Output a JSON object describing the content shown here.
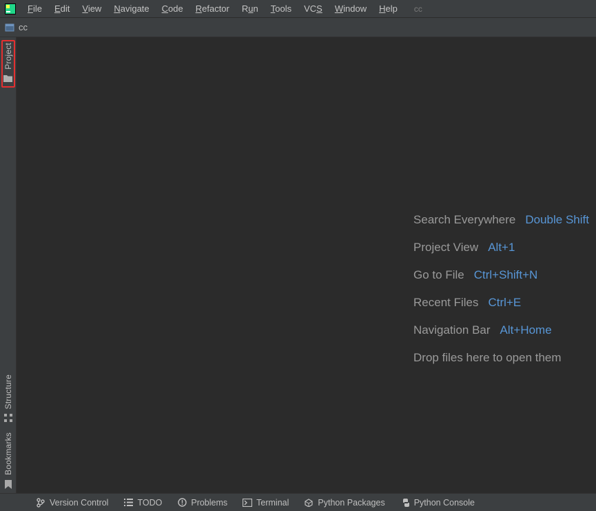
{
  "project_name": "cc",
  "menu": {
    "items": [
      {
        "label": "File",
        "mn": "F"
      },
      {
        "label": "Edit",
        "mn": "E"
      },
      {
        "label": "View",
        "mn": "V"
      },
      {
        "label": "Navigate",
        "mn": "N"
      },
      {
        "label": "Code",
        "mn": "C"
      },
      {
        "label": "Refactor",
        "mn": "R"
      },
      {
        "label": "Run",
        "mn": "u"
      },
      {
        "label": "Tools",
        "mn": "T"
      },
      {
        "label": "VCS",
        "mn": "S"
      },
      {
        "label": "Window",
        "mn": "W"
      },
      {
        "label": "Help",
        "mn": "H"
      }
    ]
  },
  "breadcrumb": {
    "label": "cc"
  },
  "left_tabs": {
    "top": [
      {
        "label": "Project",
        "icon": "folder-icon",
        "highlighted": true
      }
    ],
    "bottom": [
      {
        "label": "Structure",
        "icon": "structure-icon"
      },
      {
        "label": "Bookmarks",
        "icon": "bookmark-icon"
      }
    ]
  },
  "welcome": {
    "rows": [
      {
        "label": "Search Everywhere",
        "shortcut": "Double Shift"
      },
      {
        "label": "Project View",
        "shortcut": "Alt+1"
      },
      {
        "label": "Go to File",
        "shortcut": "Ctrl+Shift+N"
      },
      {
        "label": "Recent Files",
        "shortcut": "Ctrl+E"
      },
      {
        "label": "Navigation Bar",
        "shortcut": "Alt+Home"
      }
    ],
    "drop_hint": "Drop files here to open them"
  },
  "bottom_tools": [
    {
      "label": "Version Control",
      "icon": "branch-icon"
    },
    {
      "label": "TODO",
      "icon": "list-icon"
    },
    {
      "label": "Problems",
      "icon": "warning-icon"
    },
    {
      "label": "Terminal",
      "icon": "terminal-icon"
    },
    {
      "label": "Python Packages",
      "icon": "packages-icon"
    },
    {
      "label": "Python Console",
      "icon": "python-icon"
    }
  ]
}
